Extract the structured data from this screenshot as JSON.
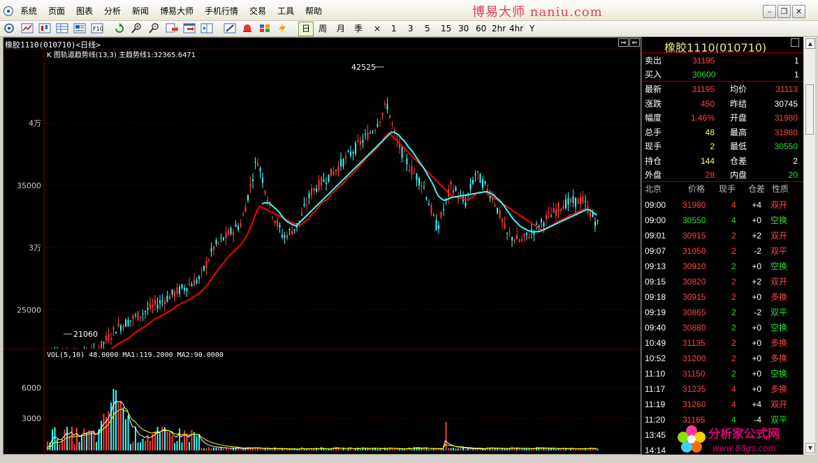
{
  "menubar": {
    "items": [
      "系统",
      "页面",
      "图表",
      "分析",
      "新闻",
      "博易大师",
      "手机行情",
      "交易",
      "工具",
      "帮助"
    ],
    "brand": "博易大师 naniu.com",
    "window_buttons": [
      "minimize-icon",
      "restore-icon",
      "close-icon"
    ]
  },
  "toolbar": {
    "icons": [
      "home-icon",
      "line-chart-icon",
      "candlestick-icon",
      "table-icon",
      "news-icon",
      "f10-icon",
      "refresh-icon",
      "zoom-in-icon",
      "zoom-out-icon",
      "export-icon",
      "window-icon",
      "draw-icon",
      "alarm-icon",
      "palette-icon",
      "lightning-icon"
    ],
    "periods": [
      "日",
      "周",
      "月",
      "季",
      "×",
      "1",
      "3",
      "5",
      "15",
      "30",
      "60",
      "2hr",
      "4hr",
      "Y"
    ],
    "active_period": "日"
  },
  "chart": {
    "header": "橡胶1110(010710)<日线>",
    "indicator_line": "K 图轨道趋势线(13,3) 主趋势线1:32365.6471",
    "price_labels": [
      "4万",
      "35000",
      "3万",
      "25000"
    ],
    "annotations": {
      "high": "42525",
      "low": "21060"
    },
    "volume_line": "VOL(5,10) 48.0000  MA1:119.2000  MA2:90.0000",
    "volume_labels": [
      "6000",
      "3000"
    ],
    "colors": {
      "up": "#ff3b3b",
      "down": "#33ffff",
      "trend": "#ff0000",
      "trend_down": "#33ffff",
      "ma1": "#ffffff",
      "ma2": "#ffff00"
    }
  },
  "quote": {
    "title": "橡胶1110(010710)",
    "orderbook": [
      {
        "label": "卖出",
        "price": "31195",
        "vol": "1"
      },
      {
        "label": "买入",
        "price": "30600",
        "vol": "1"
      }
    ],
    "stats": [
      {
        "l1": "最新",
        "v1": "31195",
        "c1": "red",
        "l2": "均价",
        "v2": "31113",
        "c2": "red"
      },
      {
        "l1": "涨跌",
        "v1": "450",
        "c1": "red",
        "l2": "昨结",
        "v2": "30745",
        "c2": "wht"
      },
      {
        "l1": "幅度",
        "v1": "1.46%",
        "c1": "red",
        "l2": "开盘",
        "v2": "31980",
        "c2": "red"
      },
      {
        "l1": "总手",
        "v1": "48",
        "c1": "yel",
        "l2": "最高",
        "v2": "31980",
        "c2": "red"
      },
      {
        "l1": "现手",
        "v1": "2",
        "c1": "yel",
        "l2": "最低",
        "v2": "30550",
        "c2": "grn"
      },
      {
        "l1": "持仓",
        "v1": "144",
        "c1": "yel",
        "l2": "仓差",
        "v2": "2",
        "c2": "wht"
      },
      {
        "l1": "外盘",
        "v1": "28",
        "c1": "red",
        "l2": "内盘",
        "v2": "20",
        "c2": "grn"
      }
    ],
    "ticks_header": [
      "北京",
      "价格",
      "现手",
      "仓差",
      "性质"
    ],
    "ticks": [
      {
        "time": "09:00",
        "price": "31980",
        "pc": "red",
        "vol": "4",
        "vc": "red",
        "diff": "+4",
        "nature": "双开",
        "nc": "red"
      },
      {
        "time": "09:00",
        "price": "30550",
        "pc": "grn",
        "vol": "4",
        "vc": "grn",
        "diff": "+0",
        "nature": "空换",
        "nc": "grn"
      },
      {
        "time": "09:01",
        "price": "30915",
        "pc": "red",
        "vol": "2",
        "vc": "red",
        "diff": "+2",
        "nature": "双开",
        "nc": "red"
      },
      {
        "time": "09:07",
        "price": "31050",
        "pc": "red",
        "vol": "2",
        "vc": "red",
        "diff": "-2",
        "nature": "双平",
        "nc": "red"
      },
      {
        "time": "09:13",
        "price": "30910",
        "pc": "red",
        "vol": "2",
        "vc": "grn",
        "diff": "+0",
        "nature": "空换",
        "nc": "grn"
      },
      {
        "time": "09:15",
        "price": "30820",
        "pc": "red",
        "vol": "2",
        "vc": "red",
        "diff": "+2",
        "nature": "双开",
        "nc": "red"
      },
      {
        "time": "09:18",
        "price": "30915",
        "pc": "red",
        "vol": "2",
        "vc": "red",
        "diff": "+0",
        "nature": "多换",
        "nc": "red"
      },
      {
        "time": "09:19",
        "price": "30865",
        "pc": "red",
        "vol": "2",
        "vc": "grn",
        "diff": "-2",
        "nature": "双平",
        "nc": "grn"
      },
      {
        "time": "09:40",
        "price": "30880",
        "pc": "red",
        "vol": "2",
        "vc": "grn",
        "diff": "+0",
        "nature": "空换",
        "nc": "grn"
      },
      {
        "time": "10:49",
        "price": "31135",
        "pc": "red",
        "vol": "2",
        "vc": "red",
        "diff": "+0",
        "nature": "多换",
        "nc": "red"
      },
      {
        "time": "10:52",
        "price": "31200",
        "pc": "red",
        "vol": "2",
        "vc": "red",
        "diff": "+0",
        "nature": "多换",
        "nc": "red"
      },
      {
        "time": "11:10",
        "price": "31150",
        "pc": "red",
        "vol": "2",
        "vc": "grn",
        "diff": "+0",
        "nature": "空换",
        "nc": "grn"
      },
      {
        "time": "11:17",
        "price": "31235",
        "pc": "red",
        "vol": "4",
        "vc": "red",
        "diff": "+0",
        "nature": "多换",
        "nc": "red"
      },
      {
        "time": "11:19",
        "price": "31260",
        "pc": "red",
        "vol": "4",
        "vc": "red",
        "diff": "+4",
        "nature": "双开",
        "nc": "red"
      },
      {
        "time": "11:20",
        "price": "31165",
        "pc": "red",
        "vol": "4",
        "vc": "grn",
        "diff": "-4",
        "nature": "双平",
        "nc": "grn"
      },
      {
        "time": "13:45",
        "price": "",
        "pc": "red",
        "vol": "",
        "vc": "red",
        "diff": "",
        "nature": "",
        "nc": "red"
      },
      {
        "time": "14:14",
        "price": "",
        "pc": "red",
        "vol": "",
        "vc": "red",
        "diff": "",
        "nature": "",
        "nc": "red"
      }
    ]
  },
  "watermark": {
    "name": "分析家公式网",
    "url": "www.88gs.com"
  }
}
